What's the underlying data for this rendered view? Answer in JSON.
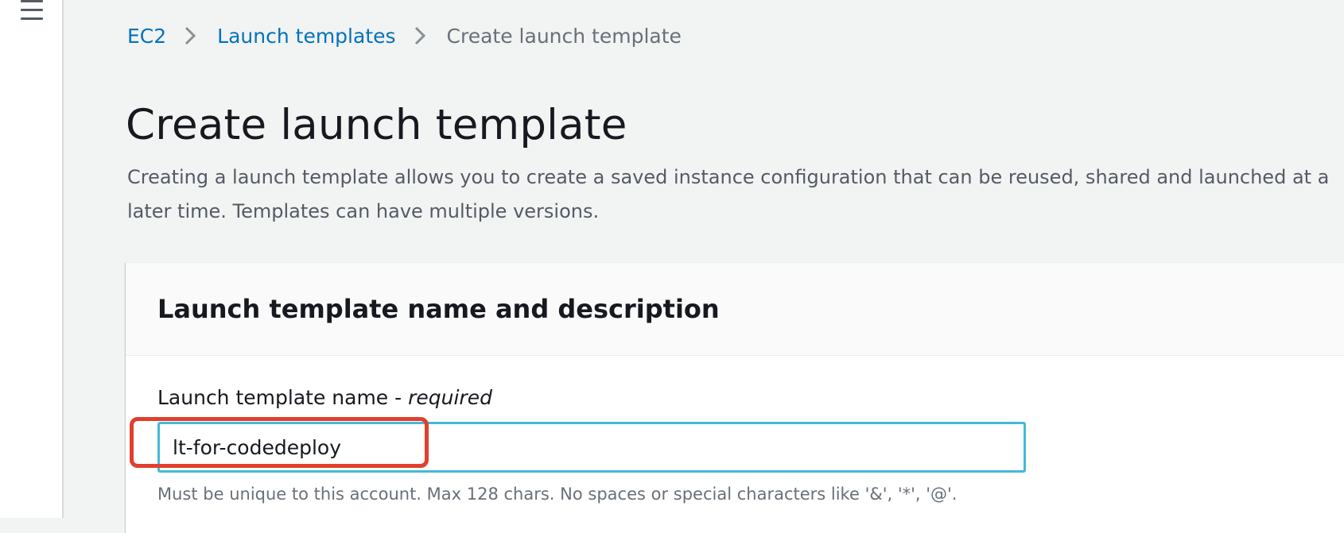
{
  "breadcrumb": {
    "items": [
      "EC2",
      "Launch templates"
    ],
    "current": "Create launch template"
  },
  "page": {
    "title": "Create launch template",
    "description": "Creating a launch template allows you to create a saved instance configuration that can be reused, shared and launched at a later time. Templates can have multiple versions."
  },
  "panel": {
    "title": "Launch template name and description",
    "name_field": {
      "label": "Launch template name - ",
      "required": "required",
      "value": "lt-for-codedeploy",
      "hint": "Must be unique to this account. Max 128 chars. No spaces or special characters like '&', '*', '@'."
    }
  },
  "colors": {
    "link": "#0073bb",
    "input_focus_border": "#44b9d6",
    "highlight_annotation": "#e0402e",
    "page_background": "#f2f3f3"
  },
  "icons": [
    "hamburger-menu-icon",
    "chevron-right-icon"
  ]
}
